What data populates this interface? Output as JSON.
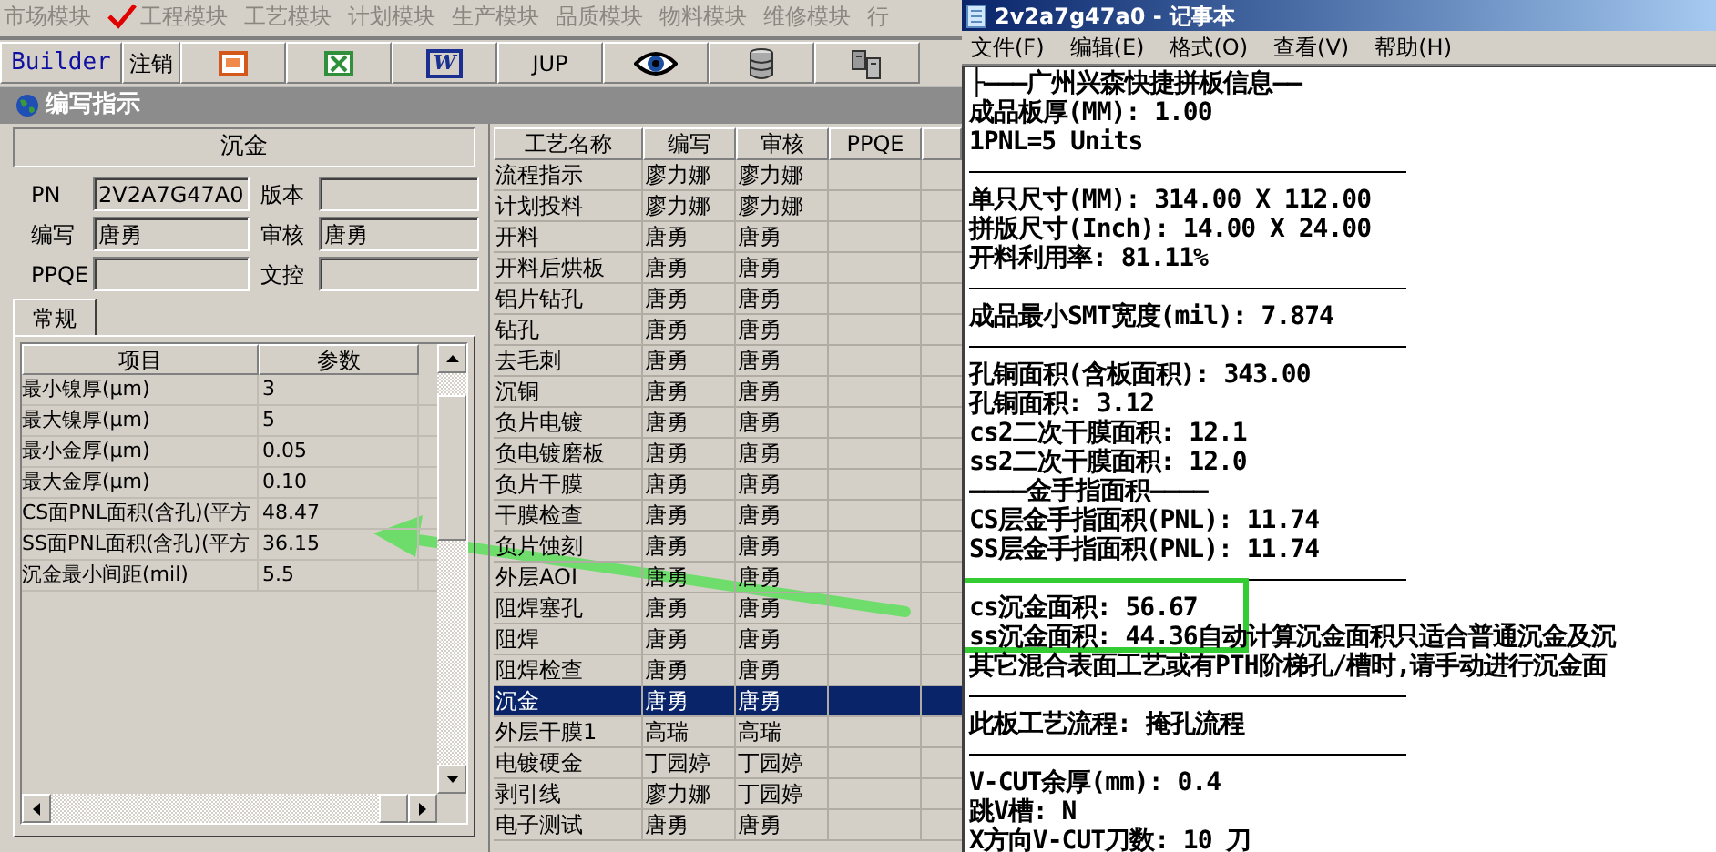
{
  "modules": [
    {
      "label": "市场模块",
      "checked": false
    },
    {
      "label": "工程模块",
      "checked": true
    },
    {
      "label": "工艺模块",
      "checked": false
    },
    {
      "label": "计划模块",
      "checked": false
    },
    {
      "label": "生产模块",
      "checked": false
    },
    {
      "label": "品质模块",
      "checked": false
    },
    {
      "label": "物料模块",
      "checked": false
    },
    {
      "label": "维修模块",
      "checked": false
    },
    {
      "label": "行",
      "checked": false
    }
  ],
  "toolbar": [
    {
      "kind": "link",
      "label": "Builder"
    },
    {
      "kind": "text",
      "label": "注销"
    },
    {
      "kind": "icon"
    },
    {
      "kind": "icon"
    },
    {
      "kind": "icon",
      "label": "W"
    },
    {
      "kind": "text",
      "label": "JUP"
    },
    {
      "kind": "icon"
    },
    {
      "kind": "icon"
    },
    {
      "kind": "icon"
    }
  ],
  "window": {
    "title": "编写指示"
  },
  "step_header": "沉金",
  "form": [
    {
      "label": "PN",
      "value": "2V2A7G47A0"
    },
    {
      "label": "版本"
    },
    {
      "label": "编写",
      "value": "唐勇"
    },
    {
      "label": "审核",
      "value": "唐勇"
    },
    {
      "label": "PPQE"
    },
    {
      "label": "文控"
    }
  ],
  "tabs": [
    {
      "label": "常规",
      "selected": true
    }
  ],
  "params": {
    "columns": [
      "项目",
      "参数"
    ],
    "rows": [
      [
        "最小镍厚(μm)",
        "3"
      ],
      [
        "最大镍厚(μm)",
        "5"
      ],
      [
        "最小金厚(μm)",
        "0.05"
      ],
      [
        "最大金厚(μm)",
        "0.10"
      ],
      [
        "CS面PNL面积(含孔)(平方",
        "48.47"
      ],
      [
        "SS面PNL面积(含孔)(平方",
        "36.15"
      ],
      [
        "沉金最小间距(mil)",
        "5.5"
      ]
    ]
  },
  "process_table": {
    "columns": [
      "工艺名称",
      "编写",
      "审核",
      "PPQE"
    ],
    "rows": [
      {
        "cells": [
          "流程指示",
          "廖力娜",
          "廖力娜"
        ],
        "selected": false
      },
      {
        "cells": [
          "计划投料",
          "廖力娜",
          "廖力娜"
        ],
        "selected": false
      },
      {
        "cells": [
          "开料",
          "唐勇",
          "唐勇"
        ],
        "selected": false
      },
      {
        "cells": [
          "开料后烘板",
          "唐勇",
          "唐勇"
        ],
        "selected": false
      },
      {
        "cells": [
          "铝片钻孔",
          "唐勇",
          "唐勇"
        ],
        "selected": false
      },
      {
        "cells": [
          "钻孔",
          "唐勇",
          "唐勇"
        ],
        "selected": false
      },
      {
        "cells": [
          "去毛刺",
          "唐勇",
          "唐勇"
        ],
        "selected": false
      },
      {
        "cells": [
          "沉铜",
          "唐勇",
          "唐勇"
        ],
        "selected": false
      },
      {
        "cells": [
          "负片电镀",
          "唐勇",
          "唐勇"
        ],
        "selected": false
      },
      {
        "cells": [
          "负电镀磨板",
          "唐勇",
          "唐勇"
        ],
        "selected": false
      },
      {
        "cells": [
          "负片干膜",
          "唐勇",
          "唐勇"
        ],
        "selected": false
      },
      {
        "cells": [
          "干膜检查",
          "唐勇",
          "唐勇"
        ],
        "selected": false
      },
      {
        "cells": [
          "负片蚀刻",
          "唐勇",
          "唐勇"
        ],
        "selected": false
      },
      {
        "cells": [
          "外层AOI",
          "唐勇",
          "唐勇"
        ],
        "selected": false
      },
      {
        "cells": [
          "阻焊塞孔",
          "唐勇",
          "唐勇"
        ],
        "selected": false
      },
      {
        "cells": [
          "阻焊",
          "唐勇",
          "唐勇"
        ],
        "selected": false
      },
      {
        "cells": [
          "阻焊检查",
          "唐勇",
          "唐勇"
        ],
        "selected": false
      },
      {
        "cells": [
          "沉金",
          "唐勇",
          "唐勇"
        ],
        "selected": true
      },
      {
        "cells": [
          "外层干膜1",
          "高瑞",
          "高瑞"
        ],
        "selected": false
      },
      {
        "cells": [
          "电镀硬金",
          "丁园婷",
          "丁园婷"
        ],
        "selected": false
      },
      {
        "cells": [
          "剥引线",
          "廖力娜",
          "丁园婷"
        ],
        "selected": false
      },
      {
        "cells": [
          "电子测试",
          "唐勇",
          "唐勇"
        ],
        "selected": false
      }
    ]
  },
  "notepad": {
    "title": "2v2a7g47a0 - 记事本",
    "menu": [
      "文件(F)",
      "编辑(E)",
      "格式(O)",
      "查看(V)",
      "帮助(H)"
    ],
    "lines": [
      {
        "kind": "text",
        "text": "├———广州兴森快捷拼板信息——"
      },
      {
        "kind": "text",
        "text": "成品板厚(MM): 1.00"
      },
      {
        "kind": "text",
        "text": "1PNL=5 Units"
      },
      {
        "kind": "rule"
      },
      {
        "kind": "text",
        "text": "单只尺寸(MM): 314.00 X 112.00"
      },
      {
        "kind": "text",
        "text": "拼版尺寸(Inch): 14.00 X 24.00"
      },
      {
        "kind": "text",
        "text": "开料利用率: 81.11%"
      },
      {
        "kind": "rule"
      },
      {
        "kind": "text",
        "text": "成品最小SMT宽度(mil): 7.874"
      },
      {
        "kind": "rule"
      },
      {
        "kind": "text",
        "text": "孔铜面积(含板面积): 343.00"
      },
      {
        "kind": "text",
        "text": "孔铜面积: 3.12"
      },
      {
        "kind": "text",
        "text": "cs2二次干膜面积: 12.1"
      },
      {
        "kind": "text",
        "text": "ss2二次干膜面积: 12.0"
      },
      {
        "kind": "text",
        "text": "————金手指面积————"
      },
      {
        "kind": "text",
        "text": "CS层金手指面积(PNL): 11.74"
      },
      {
        "kind": "text",
        "text": "SS层金手指面积(PNL): 11.74"
      },
      {
        "kind": "rule"
      },
      {
        "kind": "text",
        "text": "cs沉金面积: 56.67"
      },
      {
        "kind": "text",
        "text": "ss沉金面积: 44.36自动计算沉金面积只适合普通沉金及沉"
      },
      {
        "kind": "text",
        "text": "其它混合表面工艺或有PTH阶梯孔/槽时,请手动进行沉金面"
      },
      {
        "kind": "rule"
      },
      {
        "kind": "text",
        "text": "此板工艺流程: 掩孔流程"
      },
      {
        "kind": "rule"
      },
      {
        "kind": "text",
        "text": "V-CUT余厚(mm): 0.4"
      },
      {
        "kind": "text",
        "text": "跳V槽: N"
      },
      {
        "kind": "text",
        "text": "X方向V-CUT刀数: 10 刀"
      }
    ]
  }
}
